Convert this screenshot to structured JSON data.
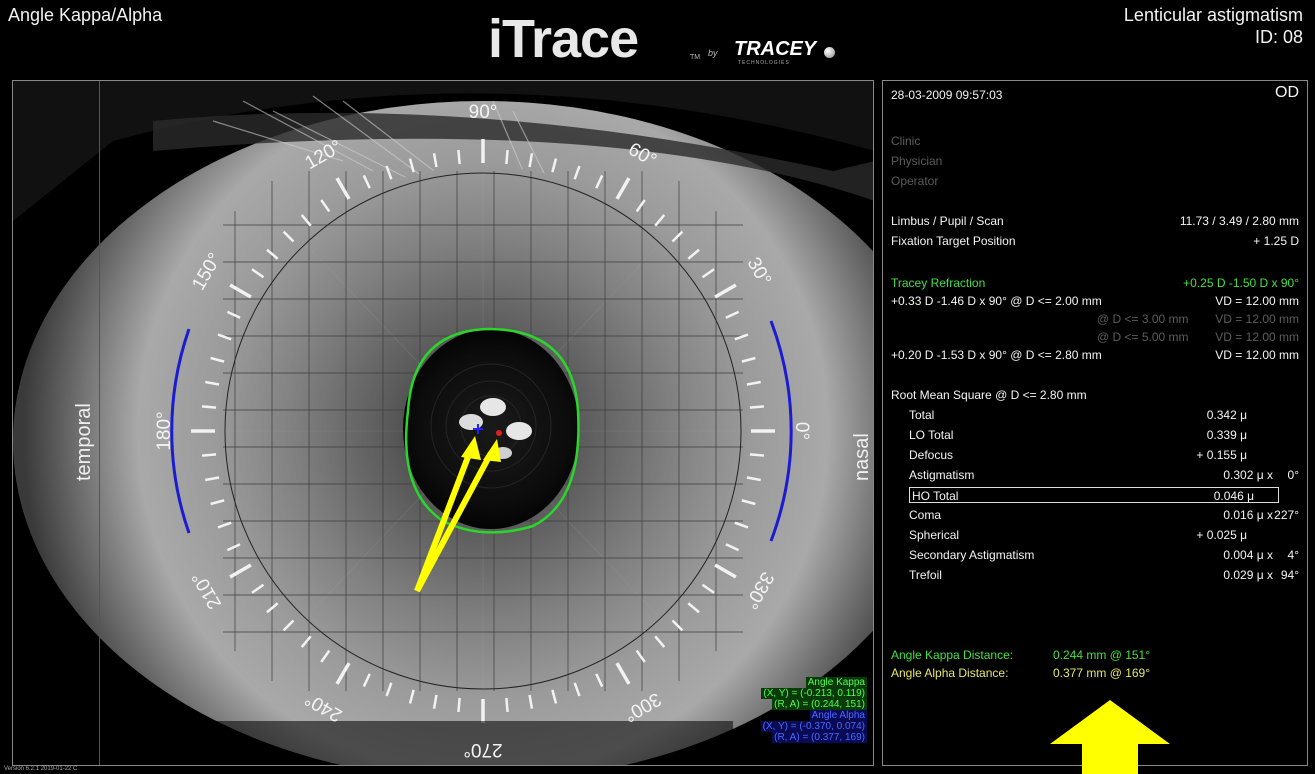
{
  "header": {
    "left_title": "Angle Kappa/Alpha",
    "logo": {
      "main": "iTrace",
      "tm": "TM",
      "by": "by",
      "brand": "TRACEY",
      "brand_sub": "TECHNOLOGIES"
    },
    "right_line1": "Lenticular astigmatism",
    "right_line2": "ID:  08"
  },
  "image": {
    "degree_labels": [
      "90°",
      "60°",
      "30°",
      "0°",
      "330°",
      "300°",
      "270°",
      "240°",
      "210°",
      "180°",
      "150°",
      "120°"
    ],
    "left_side_label": "temporal",
    "right_side_label": "nasal",
    "legend": {
      "kappa_title": "Angle Kappa",
      "kappa_xy": "(X, Y) = (-0.213, 0.119)",
      "kappa_ra": "(R, A) = (0.244, 151)",
      "alpha_title": "Angle Alpha",
      "alpha_xy": "(X, Y) = (-0.370, 0.074)",
      "alpha_ra": "(R, A) = (0.377, 169)"
    },
    "colors": {
      "limbus_arc": "#1b1bd0",
      "pupil_outline": "#2bd62b",
      "arrow": "#ffff00"
    }
  },
  "version": "Version 6.2.1 2019-01-22 C",
  "panel": {
    "datetime": "28-03-2009  09:57:03",
    "eye": "OD",
    "clinic": "Clinic",
    "physician": "Physician",
    "operator": "Operator",
    "lps_label": "Limbus / Pupil / Scan",
    "lps_value": "11.73 / 3.49 / 2.80 mm",
    "fix_label": "Fixation Target Position",
    "fix_value": "+ 1.25 D",
    "refraction_label": "Tracey Refraction",
    "refraction_value": "+0.25 D -1.50 D x 90°",
    "ref_rows": [
      {
        "left": "+0.33 D    -1.46 D x  90°  @ D <= 2.00 mm",
        "right": "VD = 12.00 mm"
      },
      {
        "left": "@ D <= 3.00 mm",
        "right": "VD = 12.00 mm"
      },
      {
        "left": "@ D <= 5.00 mm",
        "right": "VD = 12.00 mm"
      },
      {
        "left": "+0.20 D    -1.53 D x  90°  @ D <= 2.80 mm",
        "right": "VD = 12.00 mm"
      }
    ],
    "rms_label": "Root Mean Square @ D <= 2.80 mm",
    "rms_rows": [
      {
        "name": "Total",
        "value": "0.342 μ",
        "axis": ""
      },
      {
        "name": "LO Total",
        "value": "0.339 μ",
        "axis": ""
      },
      {
        "name": "Defocus",
        "value": "+ 0.155 μ",
        "axis": ""
      },
      {
        "name": "Astigmatism",
        "value": "0.302 μ x",
        "axis": "0°"
      },
      {
        "name": "HO Total",
        "value": "0.046 μ",
        "axis": ""
      },
      {
        "name": "Coma",
        "value": "0.016 μ x",
        "axis": "227°"
      },
      {
        "name": "Spherical",
        "value": "+ 0.025 μ",
        "axis": ""
      },
      {
        "name": "Secondary Astigmatism",
        "value": "0.004 μ x",
        "axis": "4°"
      },
      {
        "name": "Trefoil",
        "value": "0.029 μ x",
        "axis": "94°"
      }
    ],
    "kappa_label": "Angle Kappa Distance:",
    "kappa_value": "0.244 mm @ 151°",
    "alpha_label": "Angle Alpha Distance:",
    "alpha_value": "0.377 mm @ 169°"
  }
}
